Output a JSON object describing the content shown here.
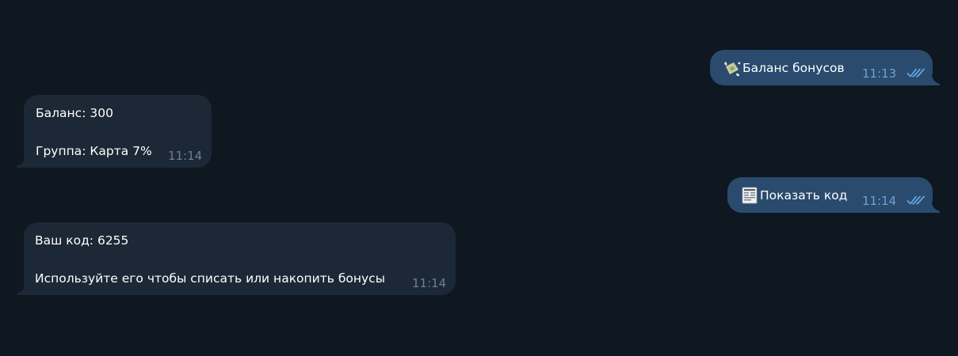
{
  "messages": [
    {
      "direction": "out",
      "emoji": "money-with-wings-icon",
      "text": "Баланс бонусов",
      "time": "11:13",
      "read": true
    },
    {
      "direction": "in",
      "lines": [
        "Баланс: 300",
        "Группа: Карта 7%"
      ],
      "time": "11:14"
    },
    {
      "direction": "out",
      "emoji": "receipt-icon",
      "text": "Показать код",
      "time": "11:14",
      "read": true
    },
    {
      "direction": "in",
      "lines": [
        "Ваш код: 6255",
        "Используйте его чтобы списать или накопить бонусы"
      ],
      "time": "11:14"
    }
  ],
  "colors": {
    "background": "#0f1721",
    "incoming_bubble": "#1c2835",
    "outgoing_bubble": "#2a4a6e",
    "read_checks": "#5fa6e6"
  }
}
